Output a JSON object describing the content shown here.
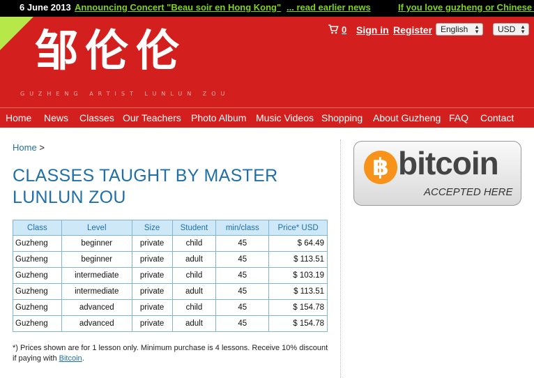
{
  "ticker": {
    "date": "6 June 2013",
    "items": [
      "Announcing Concert \"Beau soir en Hong Kong\"",
      "... read earlier news",
      "If you love guzheng or Chinese mu"
    ]
  },
  "header": {
    "logo_chars": [
      "邹",
      "伦",
      "伦"
    ],
    "tagline": "GUZHENG ARTIST LUNLUN ZOU",
    "cart_count": "0",
    "sign_in": "Sign in",
    "register": "Register",
    "language": "English",
    "currency": "USD"
  },
  "nav": [
    "Home",
    "News",
    "Classes",
    "Our Teachers",
    "Photo Album",
    "Music Videos",
    "Shopping",
    "About Guzheng",
    "FAQ",
    "Contact"
  ],
  "breadcrumb": {
    "home": "Home",
    "sep": ">"
  },
  "page_title": "CLASSES TAUGHT BY MASTER LUNLUN ZOU",
  "table": {
    "headers": [
      "Class",
      "Level",
      "Size",
      "Student",
      "min/class",
      "Price* USD"
    ],
    "rows": [
      [
        "Guzheng",
        "beginner",
        "private",
        "child",
        "45",
        "$ 64.49"
      ],
      [
        "Guzheng",
        "beginner",
        "private",
        "adult",
        "45",
        "$ 113.51"
      ],
      [
        "Guzheng",
        "intermediate",
        "private",
        "child",
        "45",
        "$ 103.19"
      ],
      [
        "Guzheng",
        "intermediate",
        "private",
        "adult",
        "45",
        "$ 113.51"
      ],
      [
        "Guzheng",
        "advanced",
        "private",
        "child",
        "45",
        "$ 154.78"
      ],
      [
        "Guzheng",
        "advanced",
        "private",
        "adult",
        "45",
        "$ 154.78"
      ]
    ]
  },
  "note": {
    "text": "*) Prices shown are for 1 lesson only. Minimum purchase is 4 lessons. Receive 10% discount if paying with",
    "link": "Bitcoin",
    "end": "."
  },
  "bitcoin_badge": {
    "symbol": "฿",
    "word": "bitcoin",
    "subtitle": "ACCEPTED HERE"
  },
  "colors": {
    "header_red": "#d3201f",
    "accent_green": "#7ed321",
    "link_blue": "#1f6fa8",
    "bitcoin_orange": "#f7931a"
  }
}
